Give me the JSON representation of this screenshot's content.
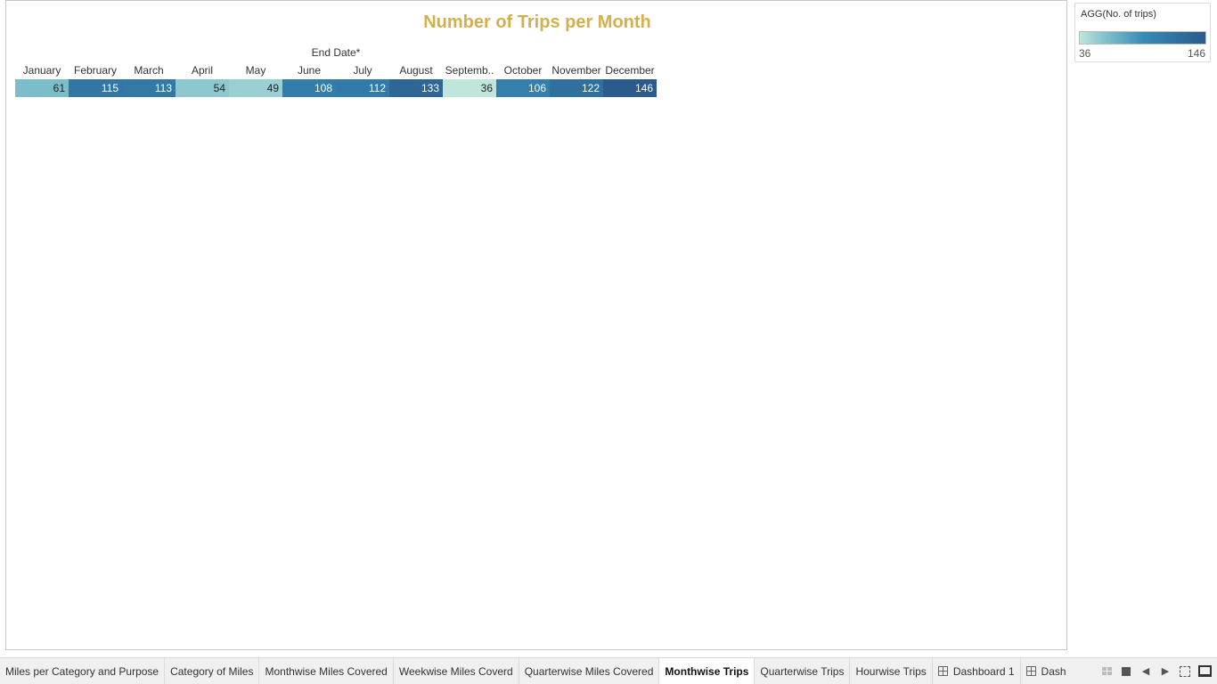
{
  "sheet": {
    "title": "Number of Trips per Month",
    "title_color": "#d4b04c"
  },
  "chart_data": {
    "type": "heatmap",
    "title": "Number of Trips per Month",
    "axis_title": "End Date*",
    "categories": [
      "January",
      "February",
      "March",
      "April",
      "May",
      "June",
      "July",
      "August",
      "Septemb..",
      "October",
      "November",
      "December"
    ],
    "values": [
      61,
      115,
      113,
      54,
      49,
      108,
      112,
      133,
      36,
      106,
      122,
      146
    ],
    "color_range": {
      "min": 36,
      "max": 146,
      "low_color": "#c0e6dc",
      "high_color": "#2b5a8c"
    }
  },
  "legend": {
    "title": "AGG(No. of trips)",
    "min_label": "36",
    "max_label": "146"
  },
  "tabs": [
    {
      "label": "Miles per Category and Purpose",
      "active": false,
      "icon": ""
    },
    {
      "label": "Category of Miles",
      "active": false,
      "icon": ""
    },
    {
      "label": "Monthwise Miles Covered",
      "active": false,
      "icon": ""
    },
    {
      "label": "Weekwise Miles Coverd",
      "active": false,
      "icon": ""
    },
    {
      "label": "Quarterwise Miles Covered",
      "active": false,
      "icon": ""
    },
    {
      "label": "Monthwise Trips",
      "active": true,
      "icon": ""
    },
    {
      "label": "Quarterwise Trips",
      "active": false,
      "icon": ""
    },
    {
      "label": "Hourwise Trips",
      "active": false,
      "icon": ""
    },
    {
      "label": "Dashboard 1",
      "active": false,
      "icon": "dashboard-icon"
    },
    {
      "label": "Dash",
      "active": false,
      "icon": "dashboard-icon"
    }
  ],
  "controls": [
    {
      "name": "show-filmstrip-icon"
    },
    {
      "name": "show-tabs-icon"
    },
    {
      "name": "previous-sheet-icon"
    },
    {
      "name": "next-sheet-icon"
    },
    {
      "name": "fit-screen-icon"
    },
    {
      "name": "presentation-mode-icon"
    }
  ]
}
